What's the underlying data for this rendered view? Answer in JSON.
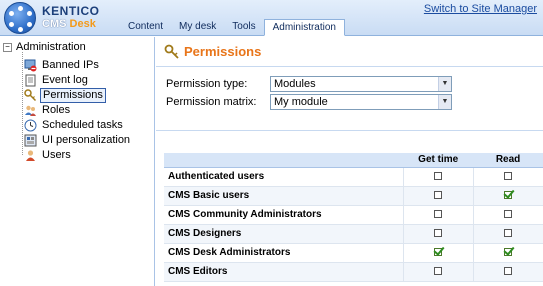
{
  "header": {
    "logo_line1": "KENTICO",
    "logo_cms": "CMS",
    "logo_desk": "Desk",
    "switch_link": "Switch to Site Manager",
    "tabs": [
      {
        "label": "Content",
        "active": false
      },
      {
        "label": "My desk",
        "active": false
      },
      {
        "label": "Tools",
        "active": false
      },
      {
        "label": "Administration",
        "active": true
      }
    ]
  },
  "tree": {
    "root": "Administration",
    "items": [
      {
        "label": "Banned IPs",
        "icon": "banned-ips-icon"
      },
      {
        "label": "Event log",
        "icon": "event-log-icon"
      },
      {
        "label": "Permissions",
        "icon": "permissions-key-icon",
        "selected": true
      },
      {
        "label": "Roles",
        "icon": "roles-icon"
      },
      {
        "label": "Scheduled tasks",
        "icon": "scheduled-tasks-icon"
      },
      {
        "label": "UI personalization",
        "icon": "ui-personalization-icon"
      },
      {
        "label": "Users",
        "icon": "users-icon"
      }
    ]
  },
  "page": {
    "title": "Permissions",
    "permission_type_label": "Permission type:",
    "permission_type_value": "Modules",
    "permission_matrix_label": "Permission matrix:",
    "permission_matrix_value": "My module"
  },
  "grid": {
    "columns": [
      "",
      "Get time",
      "Read"
    ],
    "rows": [
      {
        "name": "Authenticated users",
        "get_time": false,
        "read": false
      },
      {
        "name": "CMS Basic users",
        "get_time": false,
        "read": true
      },
      {
        "name": "CMS Community Administrators",
        "get_time": false,
        "read": false
      },
      {
        "name": "CMS Designers",
        "get_time": false,
        "read": false
      },
      {
        "name": "CMS Desk Administrators",
        "get_time": true,
        "read": true
      },
      {
        "name": "CMS Editors",
        "get_time": false,
        "read": false
      }
    ]
  },
  "colors": {
    "title_orange": "#e8751a",
    "link_blue": "#1b4ca0",
    "header_blue": "#c9dcf4",
    "check_green": "#2e8b1f"
  }
}
